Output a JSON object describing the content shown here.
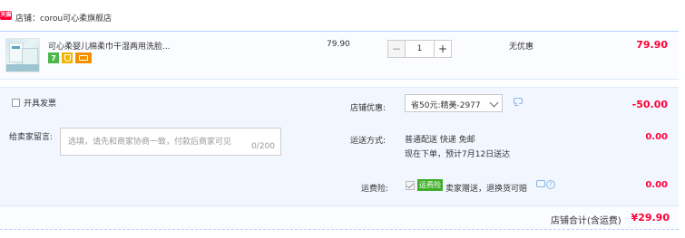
{
  "shop": {
    "badge": "天猫",
    "label": "店铺：corou可心柔旗舰店"
  },
  "item": {
    "title": "可心柔婴儿棉柔巾干湿两用洗脸...",
    "unit_price": "79.90",
    "quantity": "1",
    "minus": "−",
    "plus": "+",
    "promo": "无优惠",
    "subtotal": "79.90",
    "service_icons": [
      "7-day-return-icon",
      "shield-guarantee-icon",
      "credit-card-icon"
    ],
    "seven_label": "7"
  },
  "order": {
    "invoice_label": "开具发票",
    "message_label": "给卖家留言:",
    "message_placeholder": "选填，请先和商家协商一致，付款后商家可见",
    "message_count": "0/200",
    "discount_label": "店铺优惠:",
    "discount_value": "省50元:精美-2977",
    "discount_amount": "-50.00",
    "shipping_label": "运送方式:",
    "shipping_line1": "普通配送 快递 免邮",
    "shipping_line2": "现在下单，预计7月12日送达",
    "shipping_amount": "0.00",
    "insurance_label": "运费险:",
    "insurance_badge": "运费险",
    "insurance_text": "卖家赠送，退换货可赔",
    "insurance_help": "?",
    "insurance_amount": "0.00"
  },
  "total": {
    "label": "店铺合计(含运费)",
    "amount": "¥29.90"
  },
  "colors": {
    "price_red": "#ff0036",
    "panel_blue": "#f2f7ff",
    "border_blue": "#b2d1ff",
    "badge_green": "#3fae29"
  }
}
